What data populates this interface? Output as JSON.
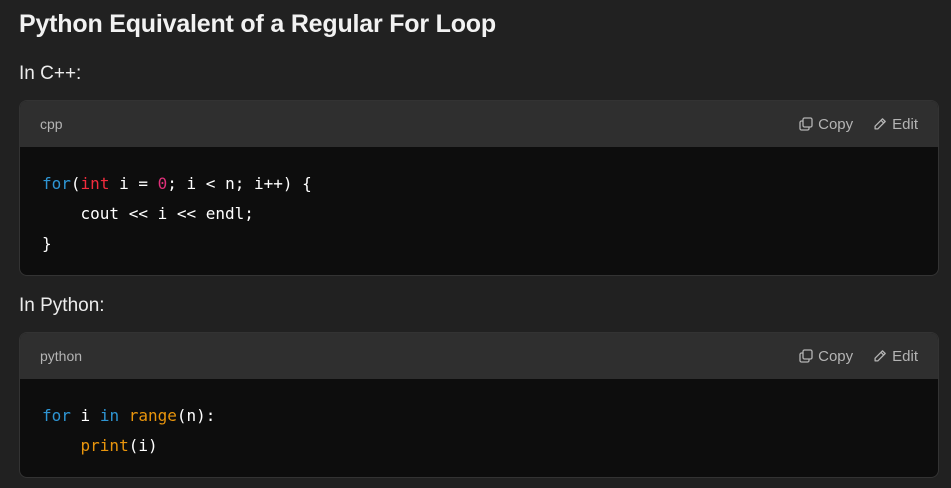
{
  "heading": "Python Equivalent of a Regular For Loop",
  "cpp_intro": "In C++:",
  "python_intro": "In Python:",
  "actions": {
    "copy": "Copy",
    "edit": "Edit"
  },
  "icons": {
    "copy": "copy-icon",
    "edit": "pencil-icon"
  },
  "colors": {
    "keyword": "#2e95d3",
    "type": "#f22c3d",
    "number": "#df3079",
    "function": "#e9950c",
    "background": "#212121",
    "code_background": "#0d0d0d",
    "header_background": "#2f2f2f"
  },
  "cpp_block": {
    "language": "cpp",
    "tokens": [
      [
        "for",
        "(",
        "int",
        " i = ",
        "0",
        "; i < n; i++) {"
      ],
      [
        "    cout << i << endl;"
      ],
      [
        "}"
      ]
    ],
    "line1": {
      "kw": "for",
      "p1": "(",
      "ty": "int",
      "a": " i = ",
      "num": "0",
      "b": "; i < n; i++) {"
    },
    "line2": "    cout << i << endl;",
    "line3": "}"
  },
  "python_block": {
    "language": "python",
    "line1": {
      "kw1": "for",
      "a": " i ",
      "kw2": "in",
      "sp": " ",
      "fn": "range",
      "b": "(n):"
    },
    "line2": {
      "indent": "    ",
      "fn": "print",
      "b": "(i)"
    }
  }
}
